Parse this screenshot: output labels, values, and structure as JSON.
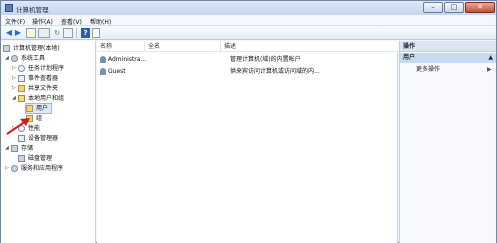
{
  "window": {
    "title": "计算机管理",
    "controls": {
      "minimize": "–",
      "maximize": "□",
      "close": "✕"
    }
  },
  "menu": [
    "文件(F)",
    "操作(A)",
    "查看(V)",
    "帮助(H)"
  ],
  "tree": {
    "root": "计算机管理(本地)",
    "system_tools": "系统工具",
    "task_scheduler": "任务计划程序",
    "event_viewer": "事件查看器",
    "shared_folders": "共享文件夹",
    "local_users_groups": "本地用户和组",
    "users": "用户",
    "groups": "组",
    "performance": "性能",
    "device_manager": "设备管理器",
    "storage": "存储",
    "disk_management": "磁盘管理",
    "services_apps": "服务和应用程序"
  },
  "list": {
    "columns": [
      "名称",
      "全名",
      "描述"
    ],
    "rows": [
      {
        "name": "Administra...",
        "fullname": "",
        "description": "管理计算机(域)的内置帐户"
      },
      {
        "name": "Guest",
        "fullname": "",
        "description": "供来宾访问计算机或访问域的内..."
      }
    ]
  },
  "actions": {
    "header": "操作",
    "section": "用户",
    "section_arrow": "▲",
    "more": "更多操作",
    "more_arrow": "▶"
  },
  "colors": {
    "annotation_arrow": "#cc1f1f"
  }
}
